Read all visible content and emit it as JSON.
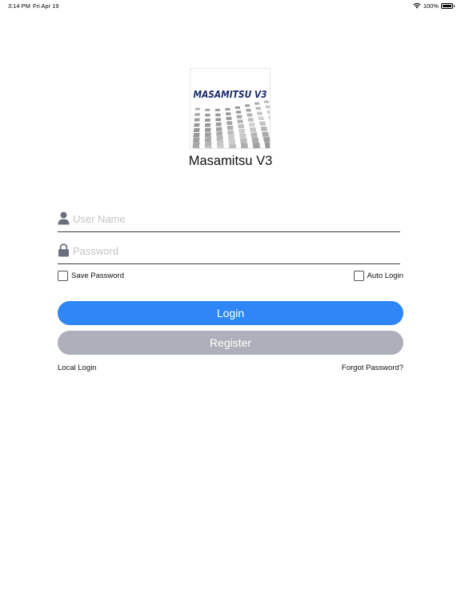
{
  "status_bar": {
    "time": "3:14 PM",
    "date": "Fri Apr 19",
    "battery": "100%",
    "battery_level": 1.0,
    "icons": [
      "wifi-icon",
      "battery-icon"
    ]
  },
  "app": {
    "logo_text": "MASAMITSU V3",
    "name": "Masamitsu V3"
  },
  "form": {
    "username": {
      "placeholder": "User Name",
      "value": "",
      "icon": "person-icon"
    },
    "password": {
      "placeholder": "Password",
      "value": "",
      "icon": "lock-icon"
    },
    "save_password": {
      "label": "Save Password",
      "checked": false
    },
    "auto_login": {
      "label": "Auto Login",
      "checked": false
    },
    "login_label": "Login",
    "register_label": "Register",
    "local_login_label": "Local Login",
    "forgot_password_label": "Forgot Password?"
  },
  "colors": {
    "login_button": "#2f86f7",
    "register_button": "#adb0ba",
    "logo_text": "#1f2d6b",
    "icon_gray": "#6b6e7d"
  }
}
